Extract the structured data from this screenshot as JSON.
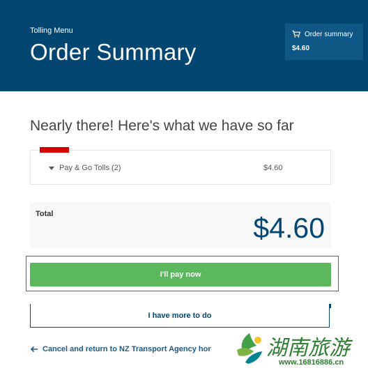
{
  "header": {
    "menu_label": "Tolling Menu",
    "page_title": "Order Summary",
    "summary_card": {
      "label": "Order summary",
      "amount": "$4.60",
      "icon": "cart-icon"
    }
  },
  "headline": "Nearly there! Here's what we have so far",
  "items": [
    {
      "name": "Pay & Go Tolls (2)",
      "price": "$4.60",
      "icon": "caret-down-icon"
    }
  ],
  "total": {
    "label": "Total",
    "amount": "$4.60"
  },
  "actions": {
    "pay_now": "I'll pay now",
    "more_to_do": "I have more to do",
    "cancel_link": "Cancel and return to NZ Transport Agency hor"
  },
  "watermark": {
    "name": "湖南旅游",
    "url": "www.16816886.cn"
  },
  "colors": {
    "header_bg": "#034672",
    "pay_button": "#5cb85c",
    "accent_red": "#d50000",
    "link": "#1d5a86"
  }
}
